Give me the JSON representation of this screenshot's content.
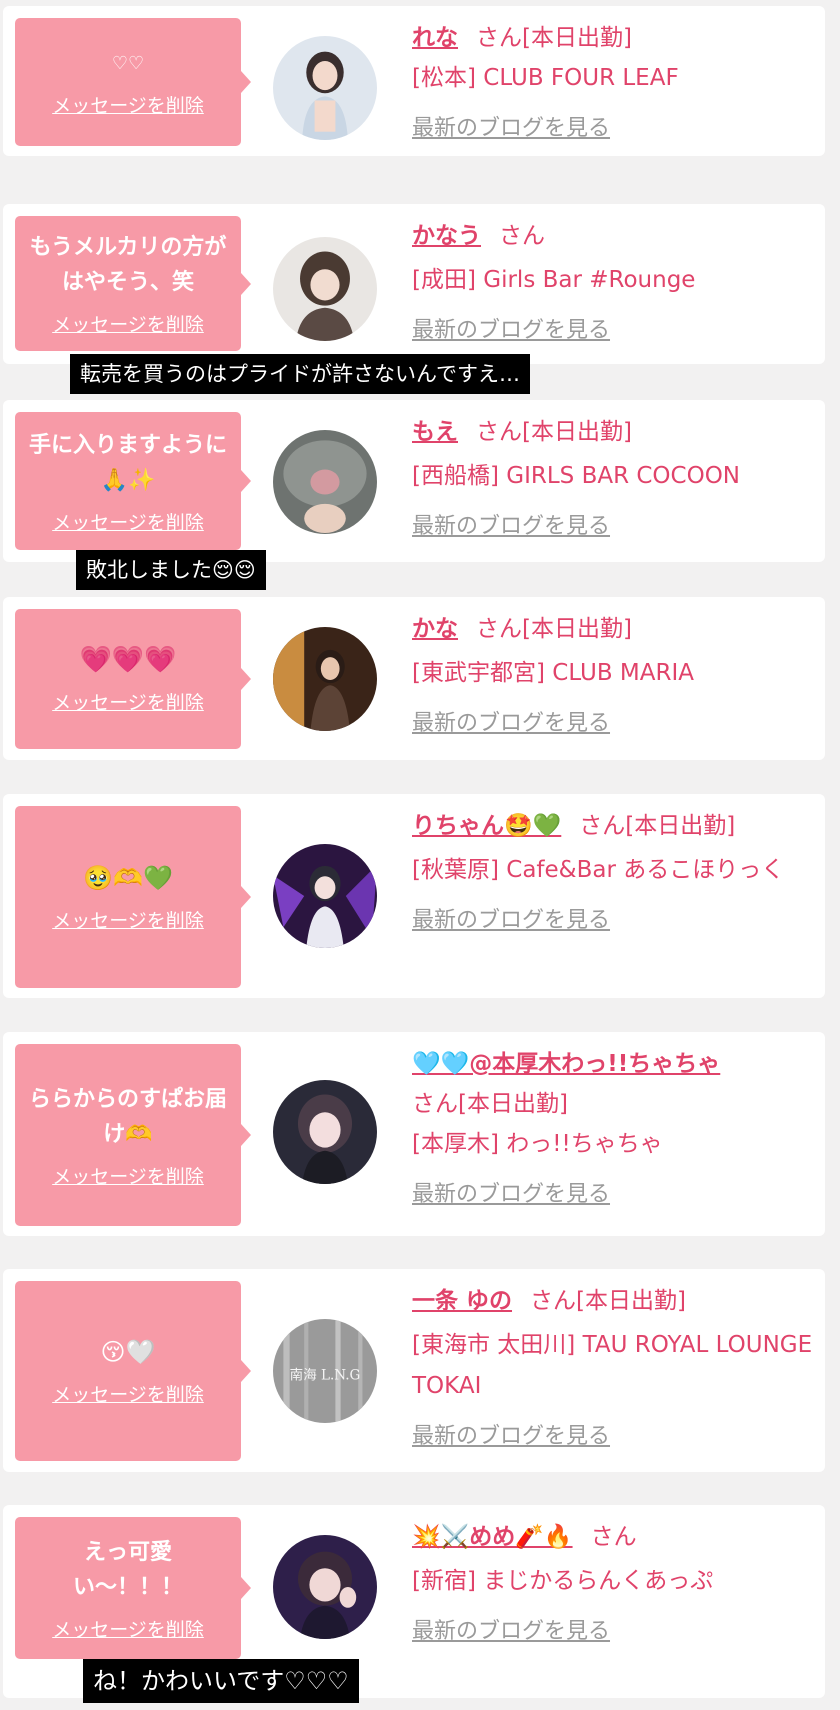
{
  "cards": [
    {
      "message": "♡♡",
      "delete_label": "メッセージを削除",
      "name": "れな",
      "san": "さん",
      "status": "[本日出勤]",
      "shop": "[松本] CLUB FOUR LEAF",
      "blog": "最新のブログを見る"
    },
    {
      "message": "もうメルカリの方がはやそう、笑",
      "delete_label": "メッセージを削除",
      "name": "かなう",
      "san": "さん",
      "status": "",
      "shop": "[成田] Girls Bar #Rounge",
      "blog": "最新のブログを見る"
    },
    {
      "message": "手に入りますように🙏✨",
      "delete_label": "メッセージを削除",
      "name": "もえ",
      "san": "さん",
      "status": "[本日出勤]",
      "shop": "[西船橋] GIRLS BAR COCOON",
      "blog": "最新のブログを見る"
    },
    {
      "message": "💗💗💗",
      "delete_label": "メッセージを削除",
      "name": "かな",
      "san": "さん",
      "status": "[本日出勤]",
      "shop": "[東武宇都宮] CLUB MARIA",
      "blog": "最新のブログを見る"
    },
    {
      "message": "🥹🫶💚",
      "delete_label": "メッセージを削除",
      "name": "りちゃん🤩💚",
      "san": "さん",
      "status": "[本日出勤]",
      "shop": "[秋葉原] Cafe&Bar あるこほりっく",
      "blog": "最新のブログを見る"
    },
    {
      "message": "ららからのすぱお届け🫶",
      "delete_label": "メッセージを削除",
      "name": "🩵🩵@本厚木わっ!!ちゃちゃ",
      "san": "さん",
      "status": "[本日出勤]",
      "shop": "[本厚木] わっ!!ちゃちゃ",
      "blog": "最新のブログを見る"
    },
    {
      "message": "😚🤍",
      "delete_label": "メッセージを削除",
      "name": "一条 ゆの",
      "san": "さん",
      "status": "[本日出勤]",
      "shop": "[東海市 太田川] TAU ROYAL LOUNGE TOKAI",
      "blog": "最新のブログを見る"
    },
    {
      "message": "えっ可愛い〜！！！",
      "delete_label": "メッセージを削除",
      "name": "💥⚔️めめ🧨🔥",
      "san": "さん",
      "status": "",
      "shop": "[新宿] まじかるらんくあっぷ",
      "blog": "最新のブログを見る"
    }
  ],
  "avatar_text": {
    "card7": "南海 L.N.G"
  },
  "captions": {
    "c1": "転売を買うのはプライドが許さないんですえ…",
    "c2": "敗北しました😌😌",
    "c3": "ね！かわいいです♡♡♡"
  },
  "colors": {
    "accent": "#e0436a",
    "bubble": "#f79aa7",
    "link_gray": "#9a9a9a"
  }
}
